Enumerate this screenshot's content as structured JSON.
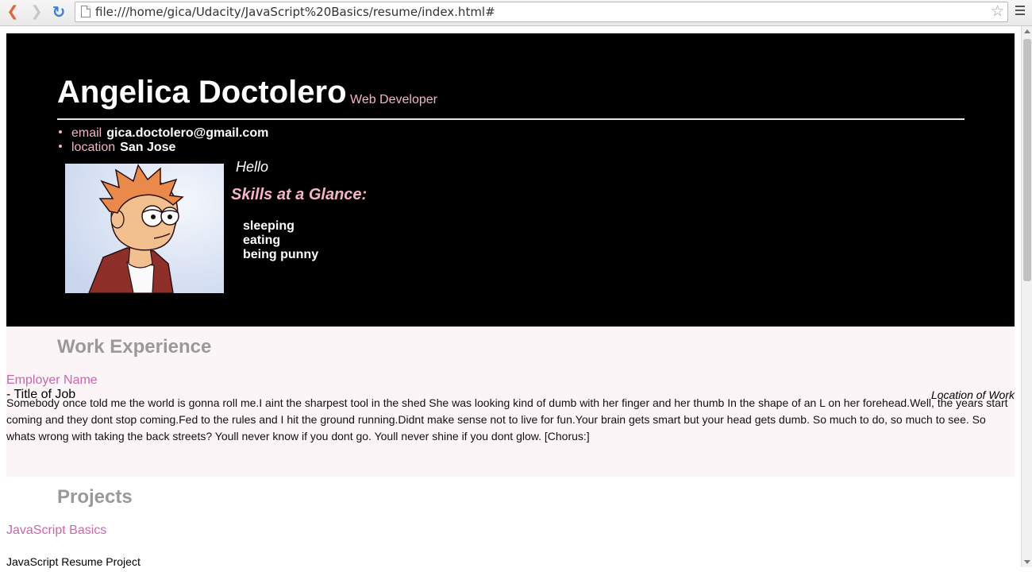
{
  "browser": {
    "url": "file:///home/gica/Udacity/JavaScript%20Basics/resume/index.html#",
    "back_icon": "back-arrow-icon",
    "forward_icon": "forward-arrow-icon",
    "reload_icon": "reload-icon",
    "star_icon": "bookmark-star-icon",
    "menu_icon": "hamburger-menu-icon"
  },
  "header": {
    "name": "Angelica Doctolero",
    "role": "Web Developer",
    "contacts": [
      {
        "label": "email",
        "value": "gica.doctolero@gmail.com"
      },
      {
        "label": "location",
        "value": "San Jose"
      }
    ],
    "welcome_message": "Hello",
    "skills_heading": "Skills at a Glance:",
    "skills": [
      "sleeping",
      "eating",
      "being punny"
    ]
  },
  "work": {
    "heading": "Work Experience",
    "jobs": [
      {
        "employer": "Employer Name",
        "title": "- Title of Job",
        "location": "Location of Work",
        "description": "Somebody once told me the world is gonna roll me.I aint the sharpest tool in the shed She was looking kind of dumb with her finger and her thumb In the shape of an L on her forehead.Well, the years start coming and they dont stop coming.Fed to the rules and I hit the ground running.Didnt make sense not to live for fun.Your brain gets smart but your head gets dumb. So much to do, so much to see. So whats wrong with taking the back streets? Youll never know if you dont go. Youll never shine if you dont glow. [Chorus:]"
      }
    ]
  },
  "projects": {
    "heading": "Projects",
    "items": [
      {
        "title": "JavaScript Basics",
        "description": "JavaScript Resume Project"
      }
    ]
  },
  "colors": {
    "header_bg": "#000000",
    "accent_pink": "#f5b3c6",
    "link_pink": "#cc66aa",
    "heading_gray": "#999999",
    "work_bg": "#fbf5f8"
  }
}
